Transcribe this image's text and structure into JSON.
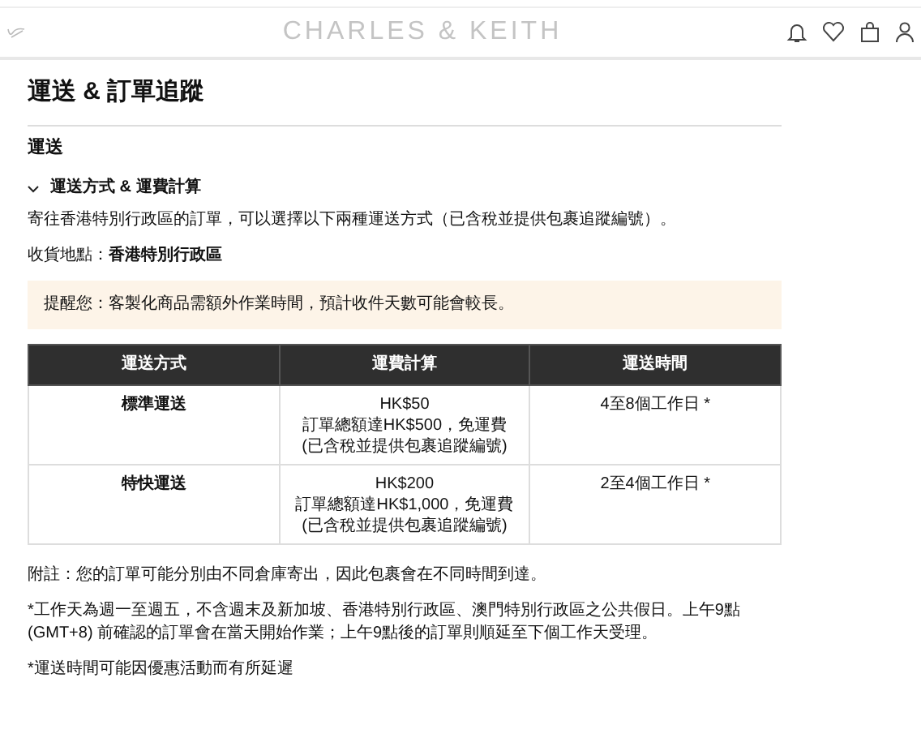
{
  "header": {
    "brand": "CHARLES & KEITH"
  },
  "page": {
    "title": "運送 & 訂單追蹤",
    "section": "運送"
  },
  "accordion": {
    "title": "運送方式 & 運費計算",
    "expanded": true
  },
  "intro": "寄往香港特別行政區的訂單，可以選擇以下兩種運送方式（已含稅並提供包裹追蹤編號）。",
  "destination": "收貨地點：**香港特別行政區**",
  "notice": "提醒您：客製化商品需額外作業時間，預計收件天數可能會較長。",
  "table": {
    "columns": [
      "運送方式",
      "運費計算",
      "運送時間"
    ],
    "rows": [
      {
        "method": "標準運送",
        "fee": [
          "HK$50",
          "訂單總額達HK$500，免運費",
          "(已含稅並提供包裹追蹤編號)"
        ],
        "time": "4至8個工作日 *"
      },
      {
        "method": "特快運送",
        "fee": [
          "HK$200",
          "訂單總額達HK$1,000，免運費",
          "(已含稅並提供包裹追蹤編號)"
        ],
        "time": "2至4個工作日 *"
      }
    ]
  },
  "notes": [
    "附註：您的訂單可能分別由不同倉庫寄出，因此包裹會在不同時間到達。",
    "*工作天為週一至週五，不含週末及新加坡、香港特別行政區、澳門特別行政區之公共假日。上午9點(GMT+8) 前確認的訂單會在當天開始作業；上午9點後的訂單則順延至下個工作天受理。",
    "*運送時間可能因優惠活動而有所延遲"
  ]
}
